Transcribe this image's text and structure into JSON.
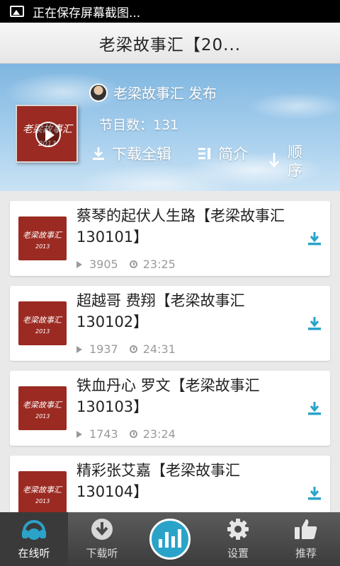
{
  "status_bar": {
    "text": "正在保存屏幕截图..."
  },
  "header": {
    "title": "老梁故事汇【20..."
  },
  "album": {
    "cover_text": "老梁故事汇",
    "cover_year": "2013",
    "author": "老梁故事汇",
    "author_suffix": "发布",
    "count_text": "节目数：131",
    "actions": {
      "download_all": "下载全辑",
      "intro": "简介",
      "order": "顺序"
    }
  },
  "episodes": [
    {
      "title": "蔡琴的起伏人生路【老梁故事汇 130101】",
      "plays": "3905",
      "duration": "23:25",
      "thumb_text": "老梁故事汇",
      "thumb_year": "2013"
    },
    {
      "title": "超越哥 费翔【老梁故事汇 130102】",
      "plays": "1937",
      "duration": "24:31",
      "thumb_text": "老梁故事汇",
      "thumb_year": "2013"
    },
    {
      "title": "铁血丹心 罗文【老梁故事汇 130103】",
      "plays": "1743",
      "duration": "23:24",
      "thumb_text": "老梁故事汇",
      "thumb_year": "2013"
    },
    {
      "title": "精彩张艾嘉【老梁故事汇 130104】",
      "plays": "",
      "duration": "",
      "thumb_text": "老梁故事汇",
      "thumb_year": "2013"
    }
  ],
  "bottom_nav": {
    "online": "在线听",
    "download": "下载听",
    "settings": "设置",
    "recommend": "推荐"
  },
  "colors": {
    "accent": "#2ba3c9",
    "cover": "#9b2a22",
    "nav_bg": "#4a4a4a"
  }
}
